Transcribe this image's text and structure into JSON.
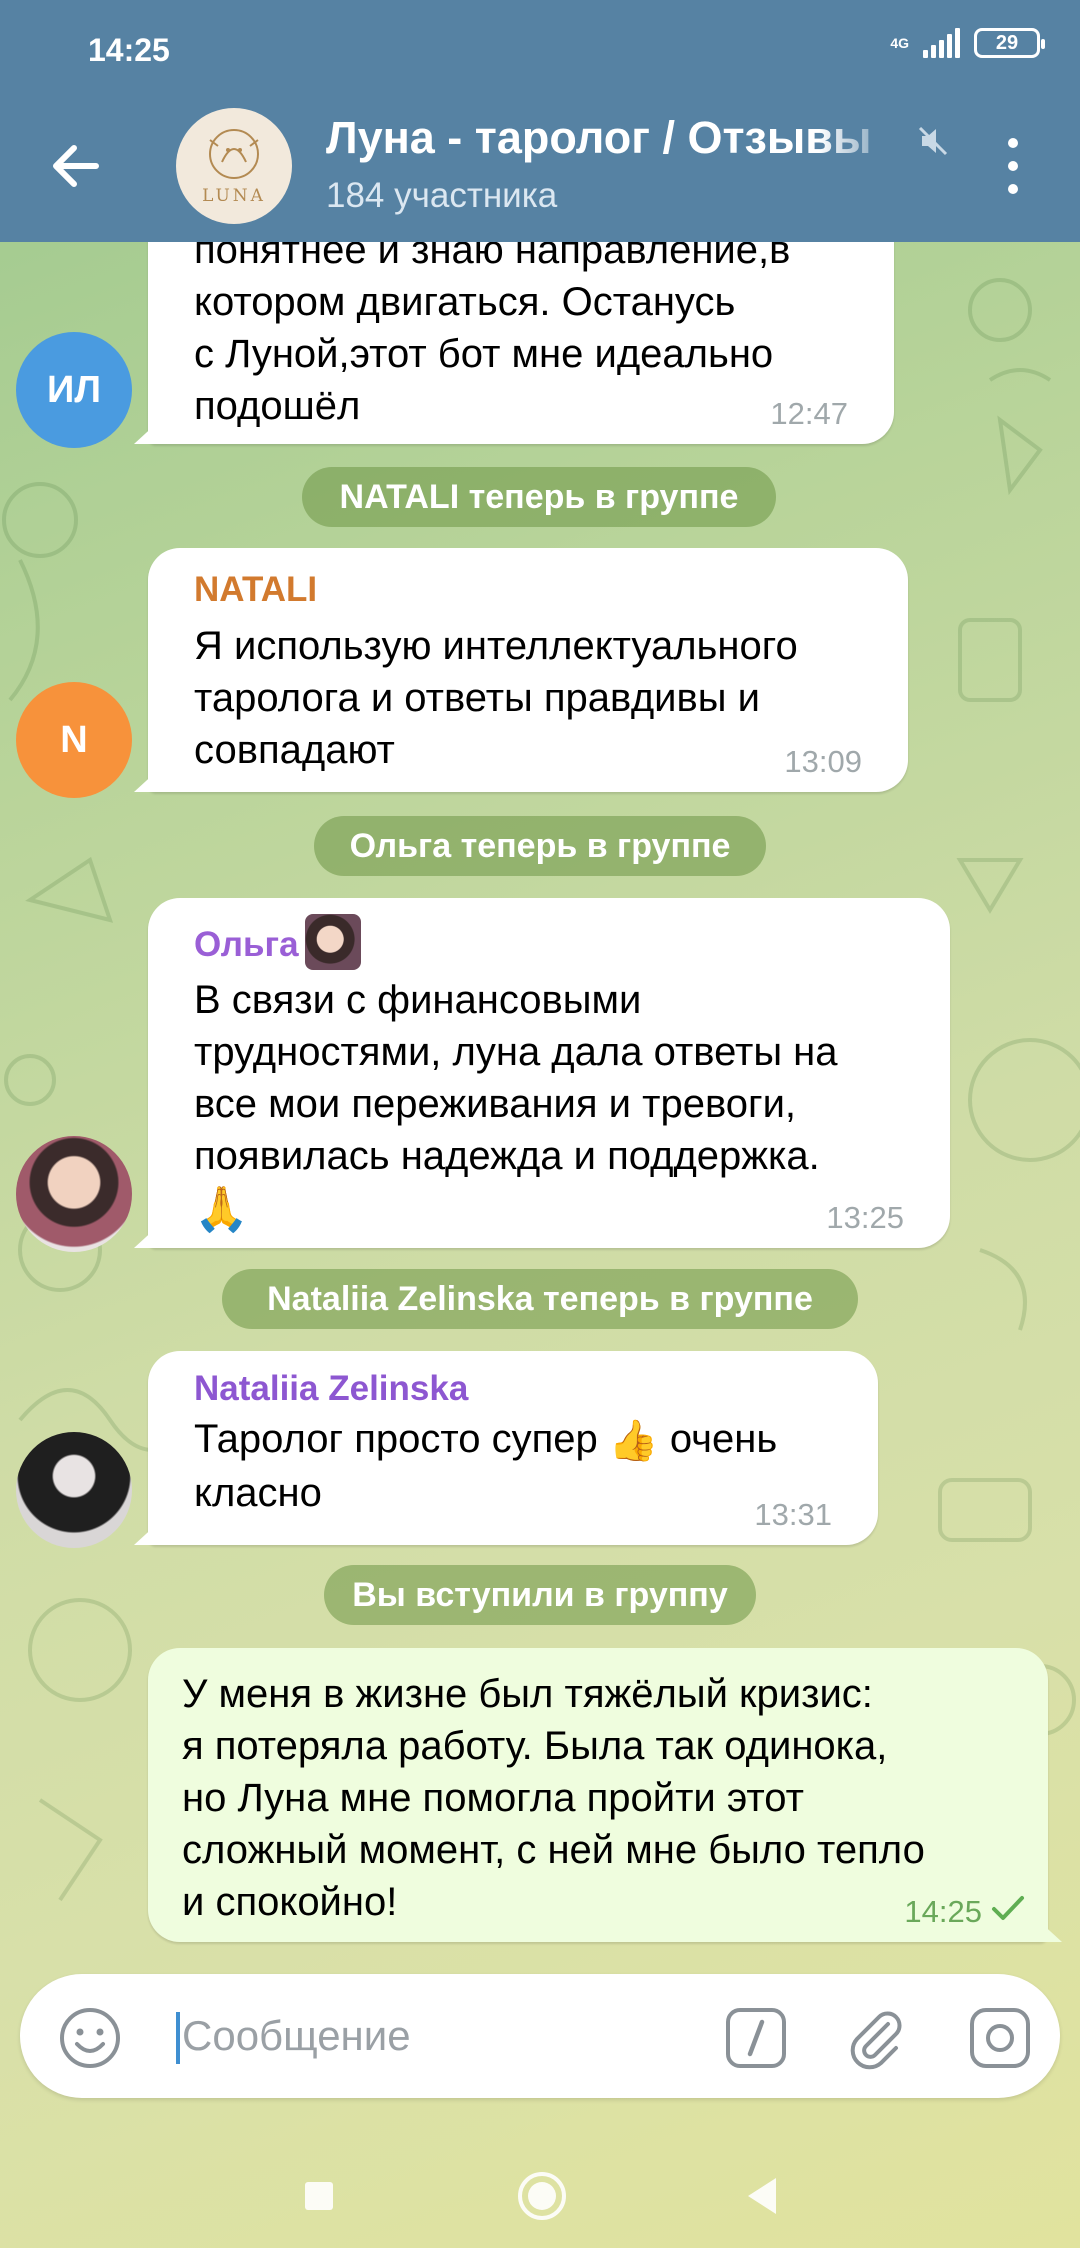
{
  "status_bar": {
    "time": "14:25",
    "network": "4G",
    "battery": "29"
  },
  "header": {
    "title": "Луна - таролог / Отзывы",
    "subtitle": "184 участника",
    "logo_text": "LUNA"
  },
  "messages": {
    "m1": {
      "text": "понятнее и знаю направление,в\nкотором двигаться. Останусь\nс Луной,этот бот мне идеально\nподошёл",
      "time": "12:47",
      "avatar_initials": "ИЛ"
    },
    "s1": {
      "text": "NATALI теперь в группе"
    },
    "m2": {
      "sender": "NATALI",
      "text": "Я использую интеллектуального\nтаролога и ответы правдивы и\nсовпадают",
      "time": "13:09",
      "avatar_initials": "N"
    },
    "s2": {
      "text": "Ольга теперь в группе"
    },
    "m3": {
      "sender": "Ольга",
      "text": "В связи с финансовыми\nтрудностями, луна дала ответы на\nвсе мои переживания и тревоги,\nпоявилась надежда и поддержка.",
      "emoji": "🙏",
      "time": "13:25"
    },
    "s3": {
      "text": "Nataliia Zelinska теперь в группе"
    },
    "m4": {
      "sender": "Nataliia Zelinska",
      "text_before": "Таролог просто супер ",
      "emoji": "👍",
      "text_after": " очень\nкласно",
      "time": "13:31"
    },
    "s4": {
      "text": "Вы вступили в группу"
    },
    "m5": {
      "text": "У меня в жизне был тяжёлый кризис:\nя потеряла работу. Была так одинока,\nно Луна мне помогла пройти этот\nсложный момент, с ней мне было тепло\nи спокойно!",
      "time": "14:25"
    }
  },
  "composer": {
    "placeholder": "Сообщение"
  },
  "colors": {
    "header": "#5682a3",
    "sender_natali": "#d27a2e",
    "sender_olga": "#9a5fd6",
    "sender_nataliia": "#8d57d1",
    "avatar_il": "#4a9be0",
    "avatar_n": "#f7923b",
    "outgoing_bubble": "#effdde"
  }
}
